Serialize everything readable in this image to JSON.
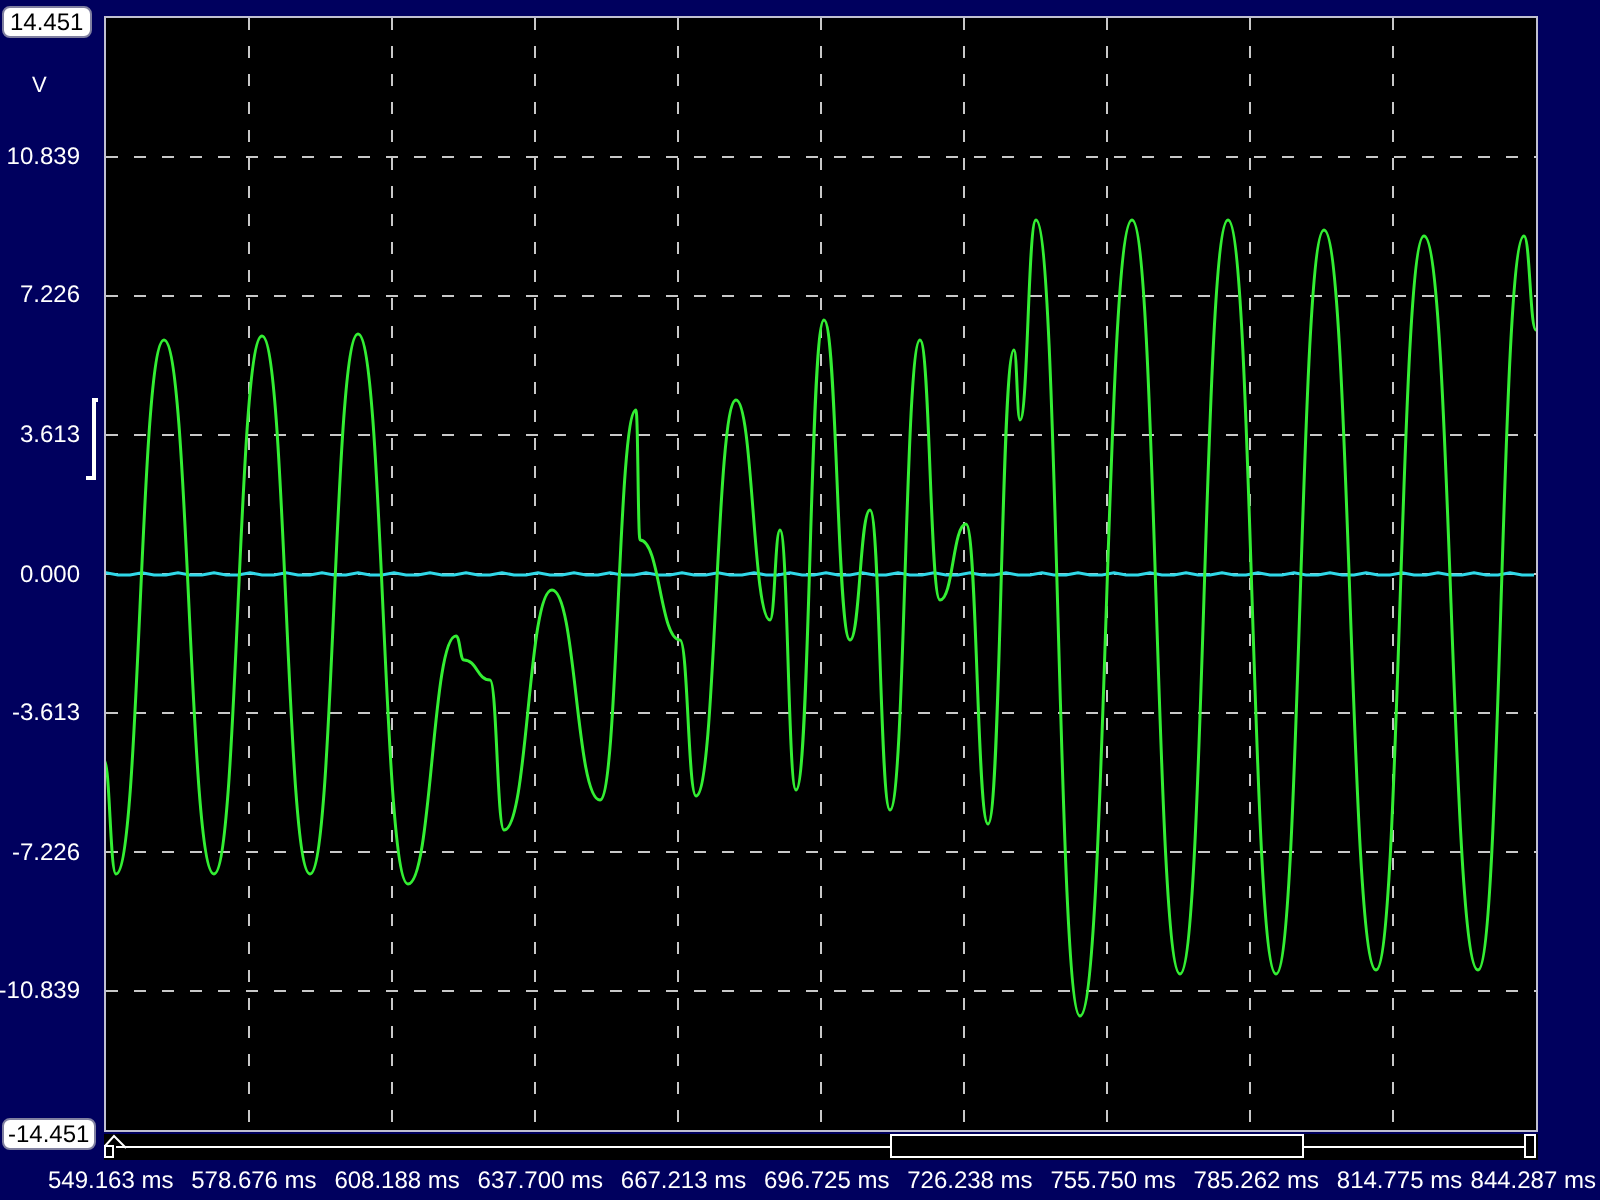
{
  "y_axis": {
    "max": "14.451",
    "unit": "V",
    "ticks": [
      "10.839",
      "7.226",
      "3.613",
      "0.000",
      "-3.613",
      "-7.226",
      "-10.839"
    ],
    "min": "-14.451"
  },
  "x_axis": {
    "ticks": [
      "549.163 ms",
      "578.676 ms",
      "608.188 ms",
      "637.700 ms",
      "667.213 ms",
      "696.725 ms",
      "726.238 ms",
      "755.750 ms",
      "785.262 ms",
      "814.775 ms",
      "844.287 ms"
    ]
  }
}
